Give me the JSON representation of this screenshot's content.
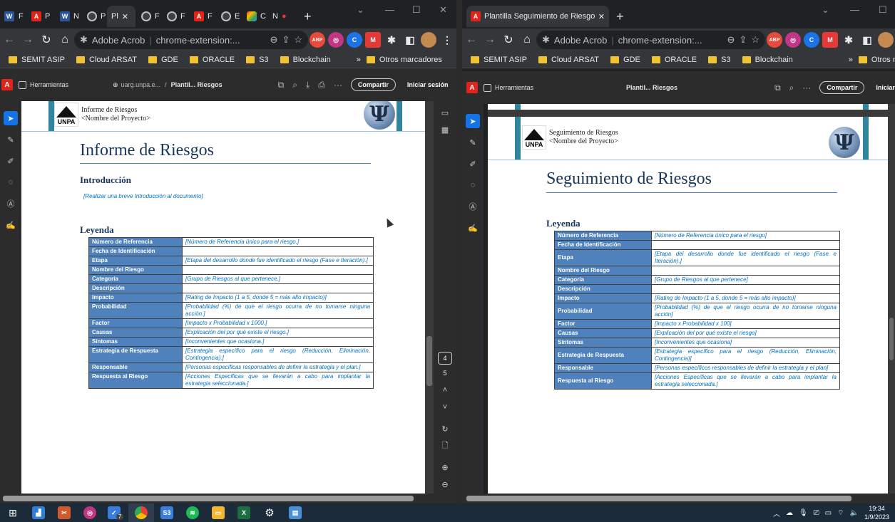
{
  "left": {
    "tabs": [
      "F",
      "P",
      "N",
      "P",
      "Pl",
      "F",
      "F",
      "F",
      "E",
      "C",
      "N"
    ],
    "omnibox": {
      "site": "Adobe Acrob",
      "url": "chrome-extension:..."
    },
    "bookmarks": [
      "SEMIT ASIP",
      "Cloud ARSAT",
      "GDE",
      "ORACLE",
      "S3",
      "Blockchain"
    ],
    "more_bookmarks": "Otros marcadores",
    "acrobat": {
      "tools": "Herramientas",
      "domain": "uarg.unpa.e...",
      "filename": "Plantil... Riesgos",
      "share": "Compartir",
      "signin": "Iniciar sesión"
    },
    "page_number": "4",
    "page_total": "5",
    "doc": {
      "header_title": "Informe de Riesgos",
      "header_sub": "<Nombre del Proyecto>",
      "logo_text": "UNPA",
      "title": "Informe de Riesgos",
      "intro_heading": "Introducción",
      "intro_text": "[Realizar una breve Introducción al documento]",
      "legend_heading": "Leyenda"
    }
  },
  "right": {
    "tab_title": "Plantilla Seguimiento de Riesgos",
    "omnibox": {
      "site": "Adobe Acrob",
      "url": "chrome-extension:..."
    },
    "bookmarks": [
      "SEMIT ASIP",
      "Cloud ARSAT",
      "GDE",
      "ORACLE",
      "S3",
      "Blockchain"
    ],
    "more_bookmarks": "Otros marca",
    "acrobat": {
      "tools": "Herramientas",
      "filename": "Plantil... Riesgos",
      "share": "Compartir",
      "signin": "Iniciar"
    },
    "doc": {
      "header_title": "Seguimiento de Riesgos",
      "header_sub": "<Nombre del Proyecto>",
      "logo_text": "UNPA",
      "title": "Seguimiento de Riesgos",
      "legend_heading": "Leyenda"
    }
  },
  "legend_left": [
    [
      "Número de Referencia",
      "[Número de Referencia único para el riesgo.]"
    ],
    [
      "Fecha de Identificación",
      ""
    ],
    [
      "Etapa",
      "[Etapa del desarrollo donde fue identificado el riesgo (Fase e Iteración).]"
    ],
    [
      "Nombre del Riesgo",
      ""
    ],
    [
      "Categoría",
      "[Grupo de Riesgos al que pertenece.]"
    ],
    [
      "Descripción",
      ""
    ],
    [
      "Impacto",
      "[Rating de Impacto (1 a 5, donde 5 = más alto impacto)]"
    ],
    [
      "Probabilidad",
      "[Probabilidad (%) de que el riesgo ocurra de no tomarse ninguna acción.]"
    ],
    [
      "Factor",
      "[Impacto x Probabilidad x 1000.]"
    ],
    [
      "Causas",
      "[Explicación del por qué existe el riesgo.]"
    ],
    [
      "Síntomas",
      "[Inconvenientes que ocasiona.]"
    ],
    [
      "Estrategia de Respuesta",
      "[Estrategia específico para el riesgo (Reducción, Eliminación, Contingencia).]"
    ],
    [
      "Responsable",
      "[Personas específicas responsables de definir la estrategia y el plan.]"
    ],
    [
      "Respuesta al Riesgo",
      "[Acciones Específicas que se llevarán a cabo para implantar la estrategia seleccionada.]"
    ]
  ],
  "legend_right": [
    [
      "Número de Referencia",
      "[Número de Referencia único para el riesgo]"
    ],
    [
      "Fecha de Identificación",
      ""
    ],
    [
      "Etapa",
      "[Etapa del desarrollo donde fue identificado el riesgo (Fase e Iteración).]"
    ],
    [
      "Nombre del Riesgo",
      ""
    ],
    [
      "Categoría",
      "[Grupo de Riesgos al que pertenece]"
    ],
    [
      "Descripción",
      ""
    ],
    [
      "Impacto",
      "[Rating de Impacto (1 a 5, donde 5 = más alto impacto)]"
    ],
    [
      "Probabilidad",
      "[Probabilidad (%) de que el riesgo ocurra de no tomarse ninguna acción]"
    ],
    [
      "Factor",
      "[Impacto x Probabilidad x 100]"
    ],
    [
      "Causas",
      "[Explicación del por qué existe el riesgo]"
    ],
    [
      "Síntomas",
      "[Inconvenientes que ocasiona]"
    ],
    [
      "Estrategia de Respuesta",
      "[Estrategia específico para el riesgo (Reducción, Eliminación, Contingencia)]"
    ],
    [
      "Responsable",
      "[Personas específicos responsables de definir la estrategia y el plan]"
    ],
    [
      "Respuesta al Riesgo",
      "[Acciones Específicas que se llevarán a cabo para implantar la estrategia seleccionada.]"
    ]
  ],
  "taskbar": {
    "time": "19:34",
    "date": "1/9/2023",
    "s3_label": "S3",
    "badge": "7"
  },
  "colors": {
    "legend_key_bg": "#4f81bd",
    "legend_value_text": "#0070c0",
    "title": "#17365d",
    "accent_bar": "#31859c"
  }
}
